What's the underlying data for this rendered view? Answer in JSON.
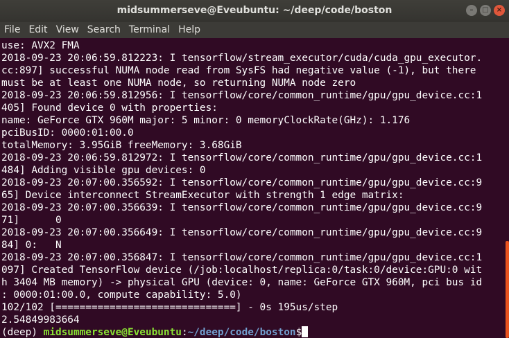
{
  "window": {
    "title": "midsummerseve@Eveubuntu: ~/deep/code/boston",
    "buttons": [
      "–",
      "□",
      "×"
    ]
  },
  "menu": [
    "File",
    "Edit",
    "View",
    "Search",
    "Terminal",
    "Help"
  ],
  "terminal": {
    "lines": [
      "use: AVX2 FMA",
      "2018-09-23 20:06:59.812223: I tensorflow/stream_executor/cuda/cuda_gpu_executor.",
      "cc:897] successful NUMA node read from SysFS had negative value (-1), but there",
      "must be at least one NUMA node, so returning NUMA node zero",
      "2018-09-23 20:06:59.812956: I tensorflow/core/common_runtime/gpu/gpu_device.cc:1",
      "405] Found device 0 with properties:",
      "name: GeForce GTX 960M major: 5 minor: 0 memoryClockRate(GHz): 1.176",
      "pciBusID: 0000:01:00.0",
      "totalMemory: 3.95GiB freeMemory: 3.68GiB",
      "2018-09-23 20:06:59.812972: I tensorflow/core/common_runtime/gpu/gpu_device.cc:1",
      "484] Adding visible gpu devices: 0",
      "2018-09-23 20:07:00.356592: I tensorflow/core/common_runtime/gpu/gpu_device.cc:9",
      "65] Device interconnect StreamExecutor with strength 1 edge matrix:",
      "2018-09-23 20:07:00.356639: I tensorflow/core/common_runtime/gpu/gpu_device.cc:9",
      "71]      0",
      "2018-09-23 20:07:00.356649: I tensorflow/core/common_runtime/gpu/gpu_device.cc:9",
      "84] 0:   N",
      "2018-09-23 20:07:00.356847: I tensorflow/core/common_runtime/gpu/gpu_device.cc:1",
      "097] Created TensorFlow device (/job:localhost/replica:0/task:0/device:GPU:0 wit",
      "h 3404 MB memory) -> physical GPU (device: 0, name: GeForce GTX 960M, pci bus id",
      ": 0000:01:00.0, compute capability: 5.0)",
      "102/102 [==============================] - 0s 195us/step",
      "2.54849983664"
    ],
    "prompt": {
      "env": "(deep) ",
      "user_host": "midsummerseve@Eveubuntu",
      "sep": ":",
      "path": "~/deep/code/boston",
      "symbol": "$"
    }
  },
  "colors": {
    "background": "#300a24",
    "prompt_user": "#8ae234",
    "prompt_path": "#729fcf",
    "scrollbar": "#e9541f"
  }
}
